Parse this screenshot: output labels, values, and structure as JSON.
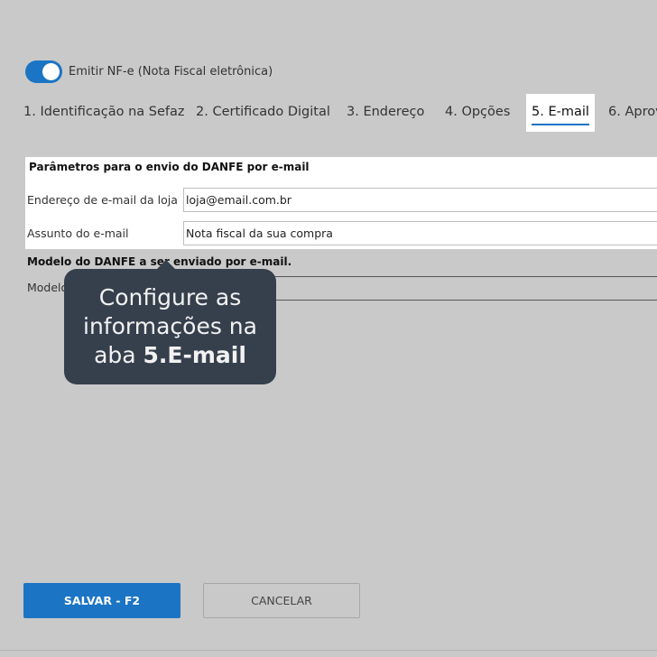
{
  "toggle": {
    "label": "Emitir NF-e (Nota Fiscal eletrônica)",
    "on": true
  },
  "tabs": [
    {
      "label": "1. Identificação na Sefaz"
    },
    {
      "label": "2. Certificado Digital"
    },
    {
      "label": "3. Endereço"
    },
    {
      "label": "4. Opções"
    },
    {
      "label": "5. E-mail",
      "active": true
    },
    {
      "label": "6. Aprov"
    }
  ],
  "panel": {
    "title": "Parâmetros para o envio do DANFE por e-mail",
    "fields": [
      {
        "label": "Endereço de e-mail da loja",
        "value": "loja@email.com.br"
      },
      {
        "label": "Assunto do e-mail",
        "value": "Nota fiscal da sua compra"
      }
    ]
  },
  "model_section": {
    "title": "Modelo do DANFE a ser enviado por e-mail.",
    "label": "Modelo"
  },
  "tooltip": {
    "line1": "Configure as",
    "line2": "informações na",
    "line3_prefix": "aba ",
    "line3_bold": "5.E-mail"
  },
  "buttons": {
    "save": "SALVAR - F2",
    "cancel": "CANCELAR"
  },
  "colors": {
    "accent": "#1b74c4",
    "overlay_bg": "#c9c9c9",
    "tooltip_bg": "#36404d"
  }
}
